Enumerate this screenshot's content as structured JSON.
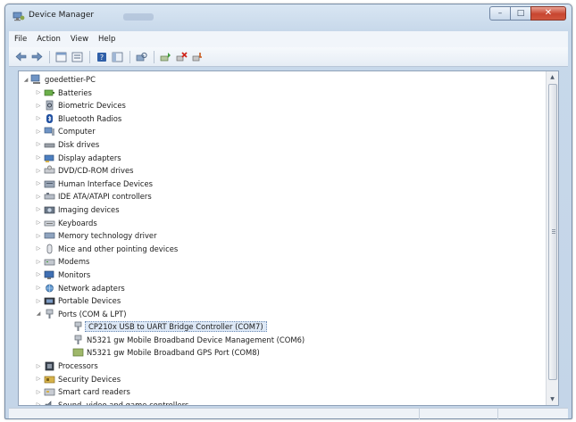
{
  "window": {
    "title": "Device Manager",
    "accent": "#c4d5e8",
    "close_color": "#c8452f"
  },
  "menu": [
    "File",
    "Action",
    "View",
    "Help"
  ],
  "toolbar": {
    "icons": [
      "back-arrow-icon",
      "forward-arrow-icon",
      "properties-icon",
      "details-icon",
      "help-icon",
      "console-icon",
      "scan-hardware-icon",
      "update-driver-icon",
      "uninstall-icon",
      "disable-icon"
    ]
  },
  "tree": {
    "root": "goedettier-PC",
    "items": [
      {
        "label": "Batteries",
        "icon": "battery-icon",
        "expanded": false
      },
      {
        "label": "Biometric Devices",
        "icon": "biometric-icon",
        "expanded": false
      },
      {
        "label": "Bluetooth Radios",
        "icon": "bluetooth-icon",
        "expanded": false
      },
      {
        "label": "Computer",
        "icon": "computer-icon",
        "expanded": false
      },
      {
        "label": "Disk drives",
        "icon": "disk-drive-icon",
        "expanded": false
      },
      {
        "label": "Display adapters",
        "icon": "display-adapter-icon",
        "expanded": false
      },
      {
        "label": "DVD/CD-ROM drives",
        "icon": "dvd-drive-icon",
        "expanded": false
      },
      {
        "label": "Human Interface Devices",
        "icon": "hid-icon",
        "expanded": false
      },
      {
        "label": "IDE ATA/ATAPI controllers",
        "icon": "ide-controller-icon",
        "expanded": false
      },
      {
        "label": "Imaging devices",
        "icon": "camera-icon",
        "expanded": false
      },
      {
        "label": "Keyboards",
        "icon": "keyboard-icon",
        "expanded": false
      },
      {
        "label": "Memory technology driver",
        "icon": "memory-icon",
        "expanded": false
      },
      {
        "label": "Mice and other pointing devices",
        "icon": "mouse-icon",
        "expanded": false
      },
      {
        "label": "Modems",
        "icon": "modem-icon",
        "expanded": false
      },
      {
        "label": "Monitors",
        "icon": "monitor-icon",
        "expanded": false
      },
      {
        "label": "Network adapters",
        "icon": "network-icon",
        "expanded": false
      },
      {
        "label": "Portable Devices",
        "icon": "portable-device-icon",
        "expanded": false
      },
      {
        "label": "Ports (COM & LPT)",
        "icon": "port-icon",
        "expanded": true,
        "children": [
          {
            "label": "CP210x USB to UART Bridge Controller (COM7)",
            "icon": "port-device-icon",
            "selected": true
          },
          {
            "label": "N5321 gw Mobile Broadband Device Management (COM6)",
            "icon": "port-device-icon",
            "selected": false
          },
          {
            "label": "N5321 gw Mobile Broadband GPS Port (COM8)",
            "icon": "gps-port-icon",
            "selected": false
          }
        ]
      },
      {
        "label": "Processors",
        "icon": "processor-icon",
        "expanded": false
      },
      {
        "label": "Security Devices",
        "icon": "security-device-icon",
        "expanded": false
      },
      {
        "label": "Smart card readers",
        "icon": "smart-card-icon",
        "expanded": false
      },
      {
        "label": "Sound, video and game controllers",
        "icon": "sound-icon",
        "expanded": false
      }
    ]
  }
}
